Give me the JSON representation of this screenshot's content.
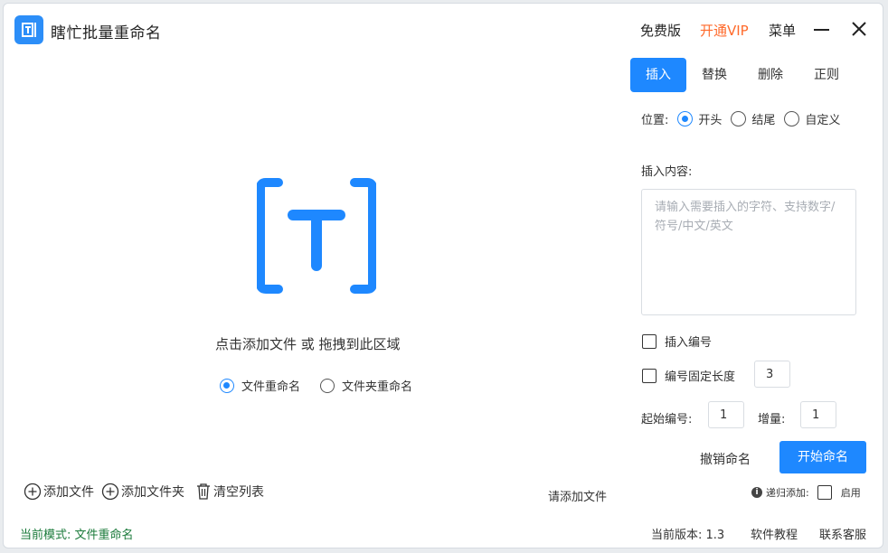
{
  "app": {
    "title": "瞎忙批量重命名"
  },
  "titlebar": {
    "free": "免费版",
    "vip": "开通VIP",
    "menu": "菜单"
  },
  "colors": {
    "accent": "#1e88ff",
    "vip": "#ff6a2b",
    "mode_text": "#1a7a3a"
  },
  "drop": {
    "hint": "点击添加文件 或 拖拽到此区域",
    "mode_file": "文件重命名",
    "mode_folder": "文件夹重命名",
    "selected_mode": "文件重命名"
  },
  "actions": {
    "add_file": "添加文件",
    "add_folder": "添加文件夹",
    "clear": "清空列表",
    "status": "请添加文件"
  },
  "tabs": [
    {
      "label": "插入",
      "active": true
    },
    {
      "label": "替换",
      "active": false
    },
    {
      "label": "删除",
      "active": false
    },
    {
      "label": "正则",
      "active": false
    }
  ],
  "insert": {
    "position_label": "位置:",
    "positions": [
      "开头",
      "结尾",
      "自定义"
    ],
    "selected_position": "开头",
    "content_label": "插入内容:",
    "content_placeholder": "请输入需要插入的字符、支持数字/符号/中文/英文",
    "seq_label": "插入编号",
    "fixed_len_label": "编号固定长度",
    "fixed_len_value": "3",
    "start_label": "起始编号:",
    "start_value": "1",
    "inc_label": "增量:",
    "inc_value": "1",
    "undo": "撤销命名",
    "start": "开始命名",
    "recur_label": "递归添加:",
    "recur_enable": "启用"
  },
  "footer": {
    "mode": "当前模式:  文件重命名",
    "version": "当前版本: 1.3",
    "tutorial": "软件教程",
    "support": "联系客服"
  }
}
